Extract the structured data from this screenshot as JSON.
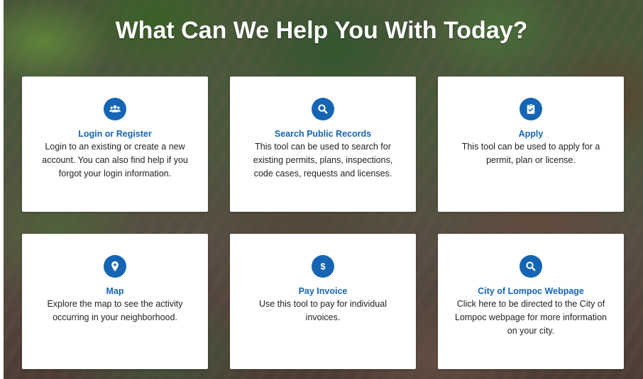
{
  "page": {
    "title": "What Can We Help You With Today?"
  },
  "colors": {
    "accent": "#1565b4",
    "card_bg": "#ffffff",
    "text": "#222222",
    "title": "#ffffff"
  },
  "cards": [
    {
      "icon": "users-icon",
      "title": "Login or Register",
      "text": "Login to an existing or create a new account. You can also find help if you forgot your login information."
    },
    {
      "icon": "search-icon",
      "title": "Search Public Records",
      "text": "This tool can be used to search for existing permits, plans, inspections, code cases, requests and licenses."
    },
    {
      "icon": "clipboard-check-icon",
      "title": "Apply",
      "text": "This tool can be used to apply for a permit, plan or license."
    },
    {
      "icon": "map-pin-icon",
      "title": "Map",
      "text": "Explore the map to see the activity occurring in your neighborhood."
    },
    {
      "icon": "dollar-icon",
      "title": "Pay Invoice",
      "text": "Use this tool to pay for individual invoices."
    },
    {
      "icon": "search-icon",
      "title": "City of Lompoc Webpage",
      "text": "Click here to be directed to the City of Lompoc webpage for more information on your city."
    }
  ]
}
